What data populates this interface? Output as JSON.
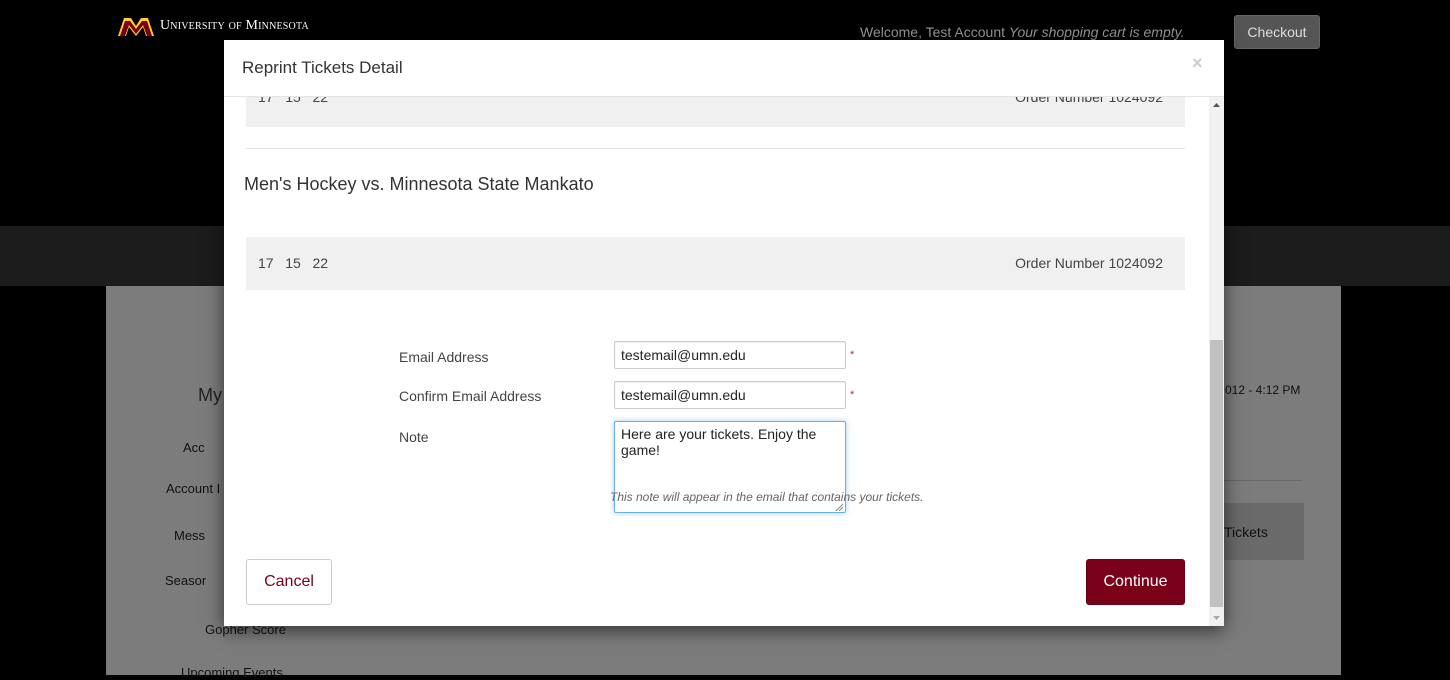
{
  "header": {
    "logo_text": "University of Minnesota",
    "welcome": "Welcome, Test Account",
    "cart_status": "Your shopping cart is empty.",
    "checkout_label": "Checkout"
  },
  "background": {
    "title_partial": "My",
    "sidebar_items": [
      "Acc",
      "Account I",
      "Mess",
      "Seasor",
      "Gopher Score",
      "Upcoming Events"
    ],
    "date_text": "012 - 4:12 PM",
    "tickets_label": "Tickets"
  },
  "modal": {
    "title": "Reprint Tickets Detail",
    "close_symbol": "×",
    "previous_row": {
      "seats": "17   15   22",
      "order": "Order Number 1024092"
    },
    "event_title": "Men's Hockey vs. Minnesota State Mankato",
    "ticket_row": {
      "seats": "17   15   22",
      "order": "Order Number 1024092"
    },
    "form": {
      "email_label": "Email Address",
      "email_value": "testemail@umn.edu",
      "confirm_label": "Confirm Email Address",
      "confirm_value": "testemail@umn.edu",
      "required_mark": "*",
      "note_label": "Note",
      "note_value": "Here are your tickets. Enjoy the game!",
      "help_text": "This note will appear in the email that contains your tickets."
    },
    "cancel_label": "Cancel",
    "continue_label": "Continue"
  },
  "colors": {
    "accent": "#7a0019",
    "focus_border": "#66afe9"
  }
}
